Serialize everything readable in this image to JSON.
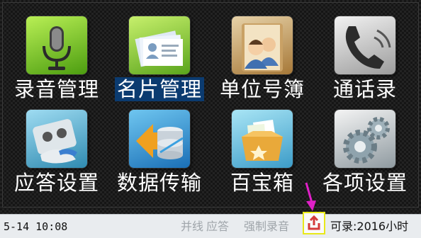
{
  "apps": [
    {
      "label": "录音管理",
      "icon": "microphone-icon",
      "name": "app-recording-management"
    },
    {
      "label": "名片管理",
      "icon": "business-card-icon",
      "name": "app-card-management",
      "selected": true
    },
    {
      "label": "单位号簿",
      "icon": "contacts-book-icon",
      "name": "app-unit-phonebook"
    },
    {
      "label": "通话录",
      "icon": "phone-handset-icon",
      "name": "app-call-log"
    },
    {
      "label": "应答设置",
      "icon": "answering-machine-icon",
      "name": "app-answer-settings"
    },
    {
      "label": "数据传输",
      "icon": "database-transfer-icon",
      "name": "app-data-transfer"
    },
    {
      "label": "百宝箱",
      "icon": "toolbox-icon",
      "name": "app-treasure-box"
    },
    {
      "label": "各项设置",
      "icon": "gears-icon",
      "name": "app-settings"
    }
  ],
  "status_bar": {
    "datetime": "5-14 10:08",
    "parallel_line": "并线",
    "answer": "应答",
    "forced_recording": "强制录音",
    "upload_icon": "upload-icon",
    "recordable": "可录:2016小时"
  },
  "colors": {
    "selected_label_bg": "#0b3b70",
    "status_bar_bg": "#e9ecef",
    "upload_highlight": "#e8e81a",
    "pointer_arrow": "#e020c8"
  }
}
